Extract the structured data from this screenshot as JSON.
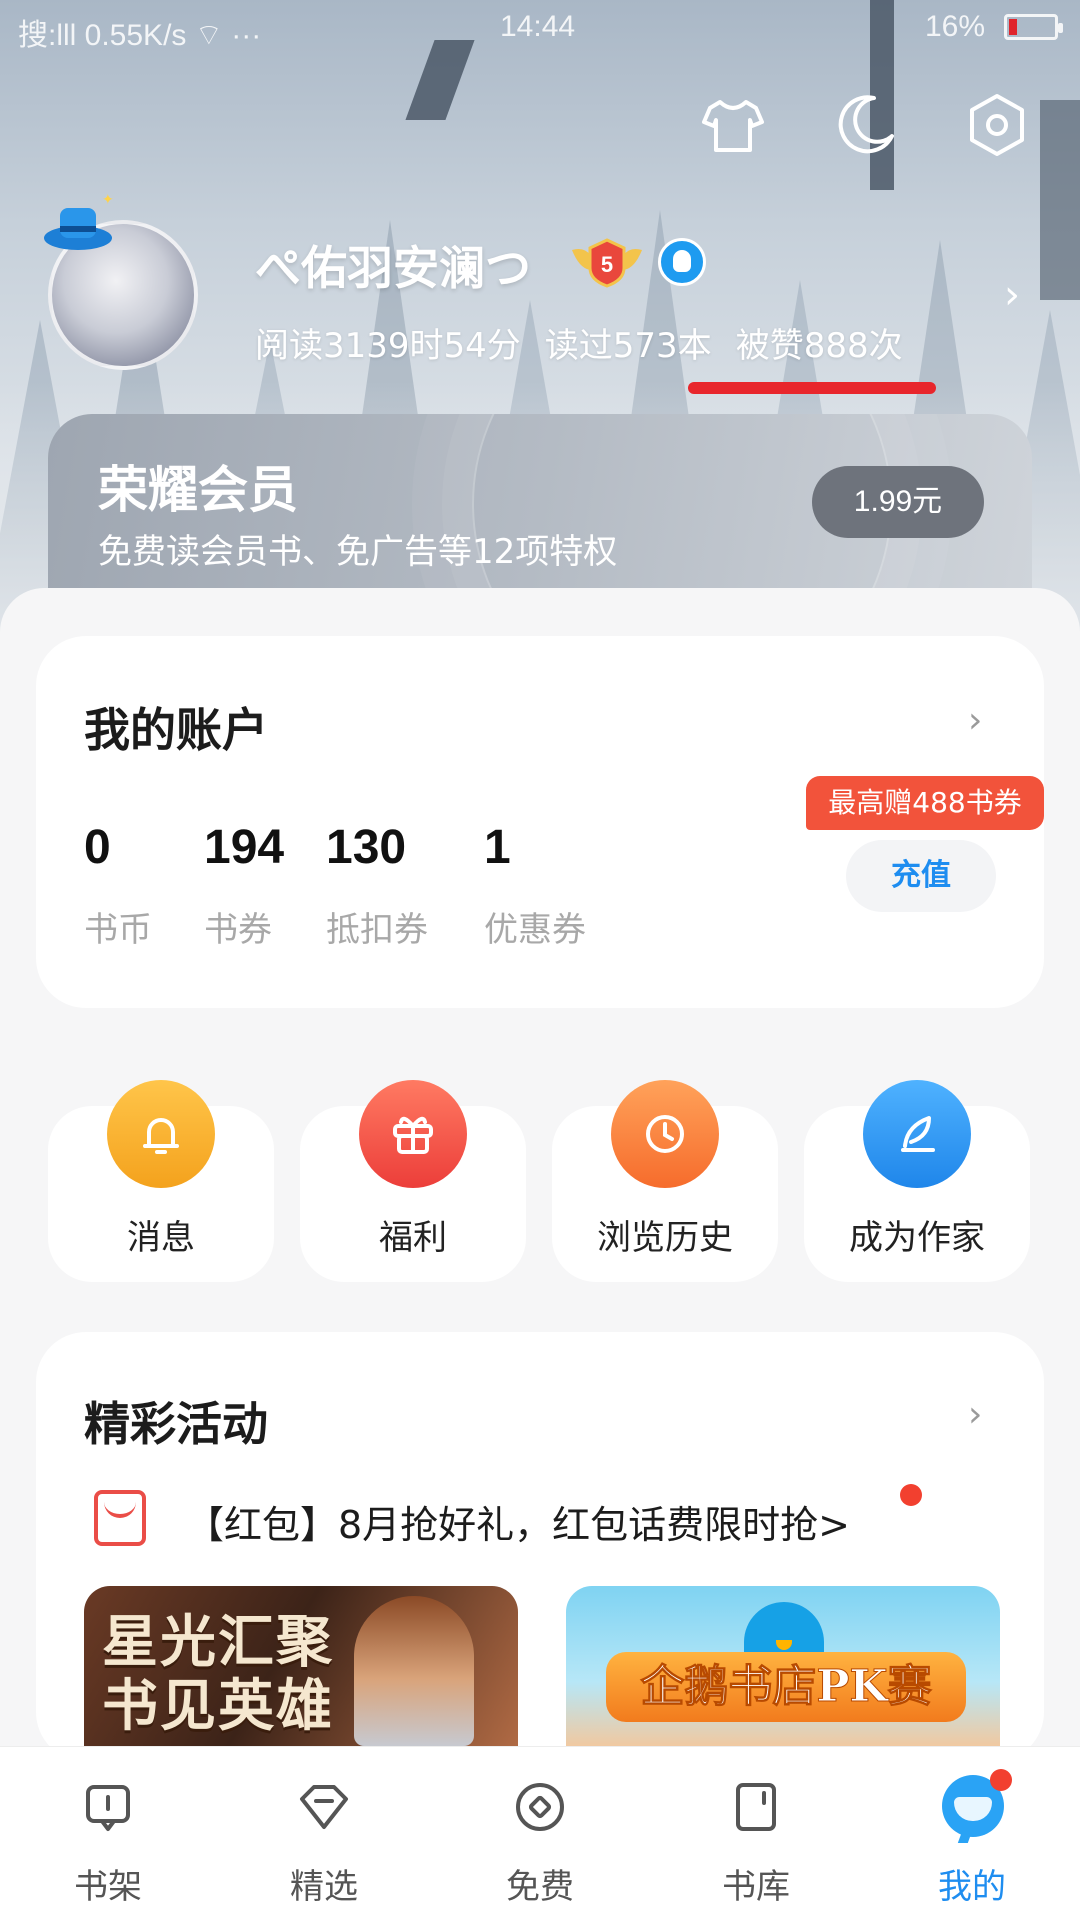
{
  "status_bar": {
    "left": "搜:lll 0.55K/s ⌔ ···",
    "time": "14:44",
    "battery": "16%"
  },
  "top_icons": [
    "shirt-icon",
    "moon-icon",
    "settings-hex-icon"
  ],
  "profile": {
    "username": "ぺ佑羽安澜つ",
    "level": "5",
    "read_time": "阅读3139时54分",
    "books_read": "读过573本",
    "likes": "被赞888次",
    "chevron": "›"
  },
  "vip": {
    "title": "荣耀会员",
    "subtitle": "免费读会员书、免广告等12项特权",
    "price": "1.99元"
  },
  "account": {
    "title": "我的账户",
    "chevron": "›",
    "items": [
      {
        "value": "0",
        "label": "书币"
      },
      {
        "value": "194",
        "label": "书券"
      },
      {
        "value": "130",
        "label": "抵扣券"
      },
      {
        "value": "1",
        "label": "优惠券"
      }
    ],
    "promo": "最高赠488书券",
    "recharge": "充值"
  },
  "quick_actions": [
    {
      "label": "消息",
      "icon": "bell-icon",
      "color": "#f7b02c"
    },
    {
      "label": "福利",
      "icon": "gift-icon",
      "color": "#f2584b"
    },
    {
      "label": "浏览历史",
      "icon": "clock-icon",
      "color": "#f97f3a"
    },
    {
      "label": "成为作家",
      "icon": "feather-icon",
      "color": "#2e95f0"
    }
  ],
  "activities": {
    "title": "精彩活动",
    "chevron": "›",
    "event": "【红包】8月抢好礼，红包话费限时抢>",
    "banners": [
      {
        "text": "星光汇聚\n书见英雄"
      },
      {
        "text": "企鹅书店PK赛"
      }
    ]
  },
  "bottom_nav": [
    {
      "label": "书架",
      "icon": "bookshelf-icon"
    },
    {
      "label": "精选",
      "icon": "featured-icon"
    },
    {
      "label": "免费",
      "icon": "free-icon"
    },
    {
      "label": "书库",
      "icon": "library-icon"
    },
    {
      "label": "我的",
      "icon": "me-icon",
      "active": true
    }
  ],
  "colors": {
    "accent": "#1e8df0",
    "promo": "#f2533b",
    "underline": "#e8262c"
  }
}
